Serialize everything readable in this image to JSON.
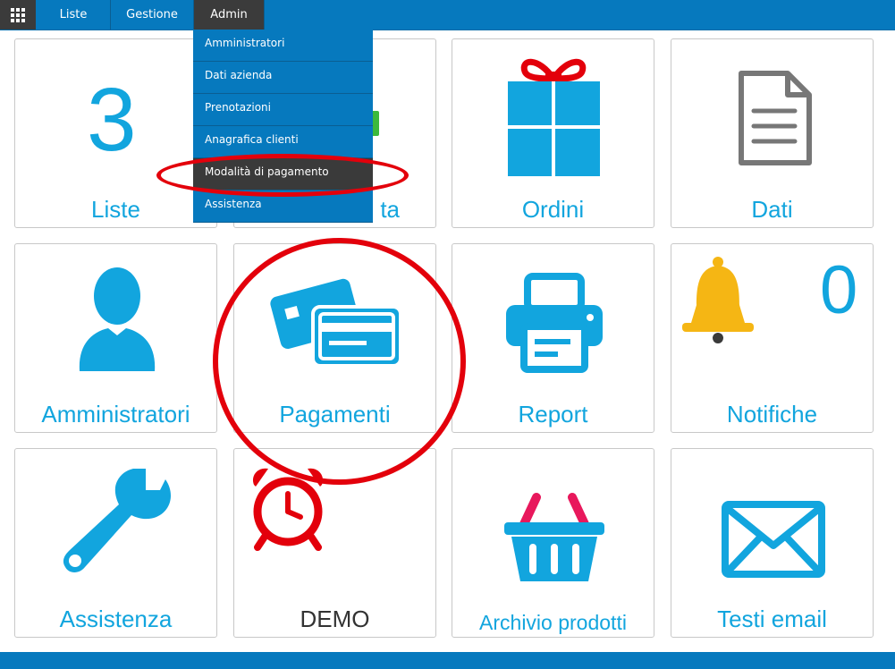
{
  "navbar": {
    "apps_icon": "grid-icon",
    "items": [
      {
        "label": "Liste"
      },
      {
        "label": "Gestione"
      },
      {
        "label": "Admin"
      }
    ]
  },
  "dropdown": {
    "items": [
      {
        "label": "Amministratori"
      },
      {
        "label": "Dati azienda"
      },
      {
        "label": "Prenotazioni"
      },
      {
        "label": "Anagrafica clienti"
      },
      {
        "label": "Modalità di pagamento"
      },
      {
        "label": "Assistenza"
      }
    ]
  },
  "tiles": [
    {
      "label": "Liste",
      "count": "3",
      "icon": "number-icon"
    },
    {
      "label": "...ta",
      "icon": "partial-icon"
    },
    {
      "label": "Ordini",
      "icon": "gift-icon"
    },
    {
      "label": "Dati",
      "icon": "document-icon"
    },
    {
      "label": "Amministratori",
      "icon": "user-icon"
    },
    {
      "label": "Pagamenti",
      "icon": "credit-card-icon"
    },
    {
      "label": "Report",
      "icon": "printer-icon"
    },
    {
      "label": "Notifiche",
      "count": "0",
      "icon": "bell-icon"
    },
    {
      "label": "Assistenza",
      "icon": "wrench-icon"
    },
    {
      "label": "DEMO",
      "icon": "alarm-clock-icon"
    },
    {
      "label": "Archivio prodotti",
      "icon": "basket-icon"
    },
    {
      "label": "Testi email",
      "icon": "envelope-icon"
    }
  ],
  "colors": {
    "primary_blue": "#0679be",
    "icon_blue": "#12a5de",
    "highlight_red": "#e3000b",
    "menu_dark": "#3b3b3b"
  }
}
